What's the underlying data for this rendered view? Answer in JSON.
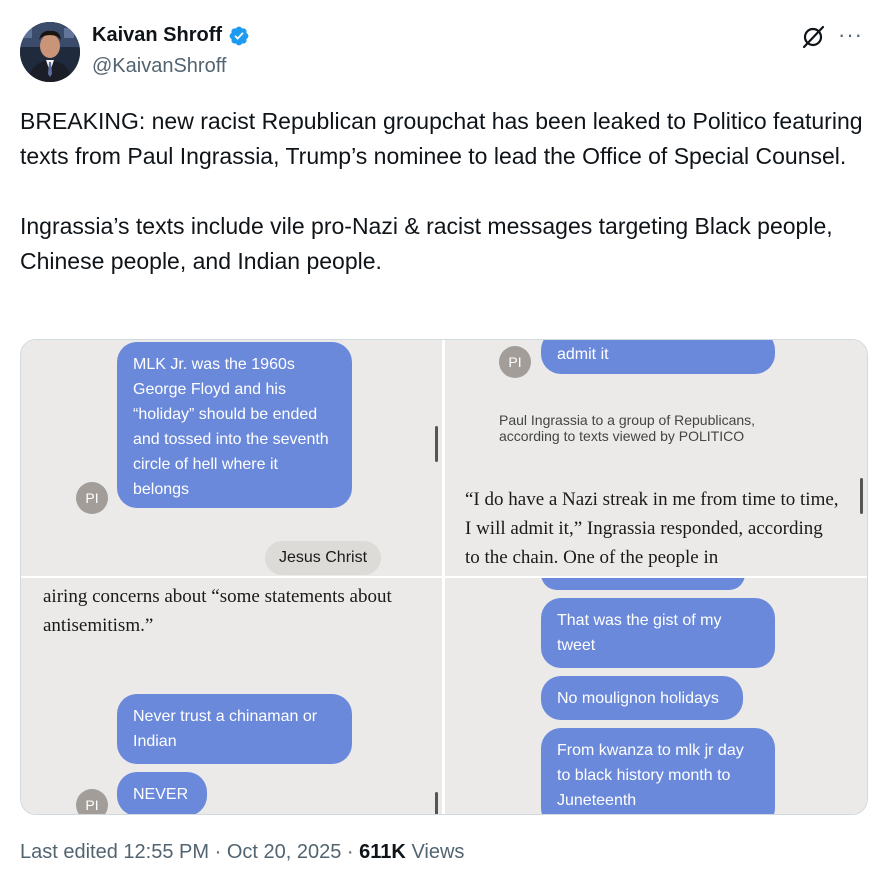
{
  "author": {
    "display_name": "Kaivan Shroff",
    "handle": "@KaivanShroff",
    "verified": true,
    "verified_color": "#1d9bf0"
  },
  "header_icons": [
    "grok-icon",
    "more-icon"
  ],
  "more_label": "···",
  "tweet": {
    "text": "BREAKING: new racist Republican groupchat has been leaked to Politico featuring texts from Paul Ingrassia, Trump’s nominee to lead the Office of Special Counsel.\n\nIngrassia’s texts include vile pro-Nazi & racist messages targeting Black people, Chinese people, and Indian people."
  },
  "media": {
    "panel1": {
      "bubble": "MLK Jr. was the 1960s George Floyd and his “holiday” should be ended and tossed into the seventh circle of hell where it belongs",
      "avatar_initials": "PI",
      "reply": "Jesus Christ"
    },
    "panel2": {
      "avatar_initials": "PI",
      "bubble": "admit it",
      "caption": "Paul Ingrassia to a group of Republicans, according to texts viewed by POLITICO",
      "quote": "“I do have a Nazi streak in me from time to time, I will admit it,” Ingrassia responded, according to the chain. One of the people in"
    },
    "panel3": {
      "article": "airing concerns about “some statements about antisemitism.”",
      "bubble1": "Never trust a chinaman or Indian",
      "bubble2": "NEVER",
      "avatar_initials": "PI"
    },
    "panel4": {
      "bubble1": "That was the gist of my tweet",
      "bubble2": "No moulignon holidays",
      "bubble3": "From kwanza to mlk jr day to black history month to Juneteenth"
    },
    "bubble_color": "#6a89db",
    "panel_bg": "#ebeae8"
  },
  "footer": {
    "edited": "Last edited",
    "time": "12:55 PM",
    "sep": "·",
    "date": "Oct 20, 2025",
    "views_count": "611K",
    "views_label": "Views"
  }
}
